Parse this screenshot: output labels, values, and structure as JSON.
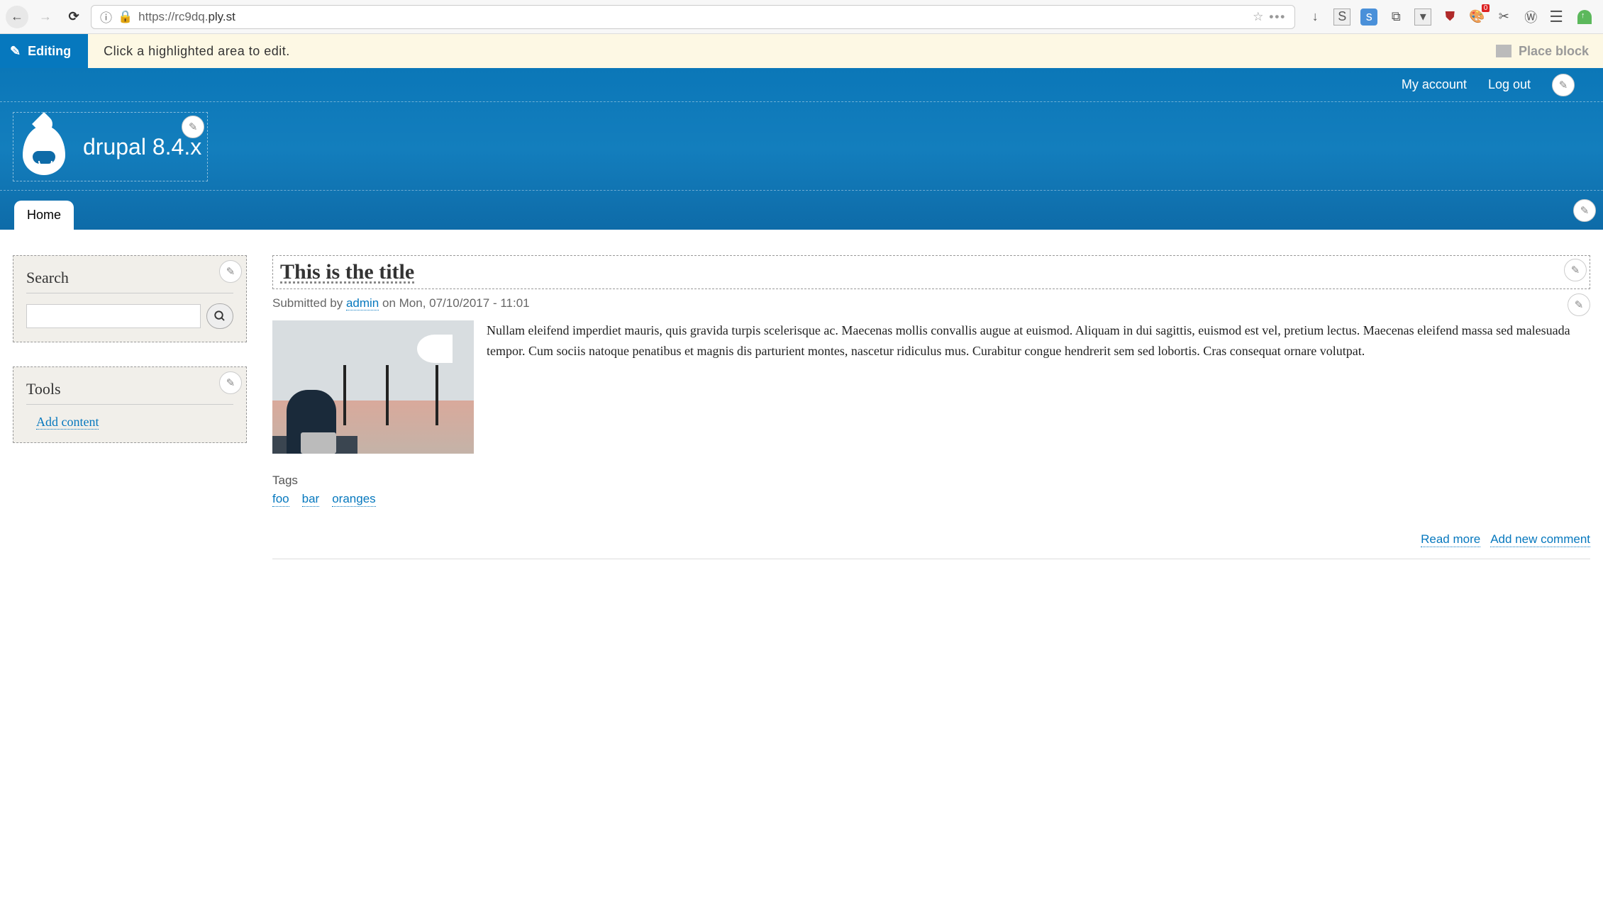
{
  "browser": {
    "url_prefix": "https://rc9dq.",
    "url_domain": "ply.st",
    "toolbar_badge": "0"
  },
  "editing_bar": {
    "label": "Editing",
    "hint": "Click a highlighted area to edit.",
    "place_block": "Place block"
  },
  "account": {
    "my_account": "My account",
    "log_out": "Log out"
  },
  "site": {
    "name": "drupal 8.4.x",
    "nav": {
      "home": "Home"
    }
  },
  "sidebar": {
    "search": {
      "title": "Search"
    },
    "tools": {
      "title": "Tools",
      "add_content": "Add content"
    }
  },
  "article": {
    "title": "This is the title",
    "submitted_prefix": "Submitted by ",
    "author": "admin",
    "submitted_suffix": " on Mon, 07/10/2017 - 11:01",
    "body": "Nullam eleifend imperdiet mauris, quis gravida turpis scelerisque ac. Maecenas mollis convallis augue at euismod. Aliquam in dui sagittis, euismod est vel, pretium lectus. Maecenas eleifend massa sed malesuada tempor. Cum sociis natoque penatibus et magnis dis parturient montes, nascetur ridiculus mus. Curabitur congue hendrerit sem sed lobortis. Cras consequat ornare volutpat.",
    "tags_label": "Tags",
    "tags": {
      "0": "foo",
      "1": "bar",
      "2": "oranges"
    },
    "links": {
      "read_more": "Read more",
      "add_comment": "Add new comment"
    }
  }
}
